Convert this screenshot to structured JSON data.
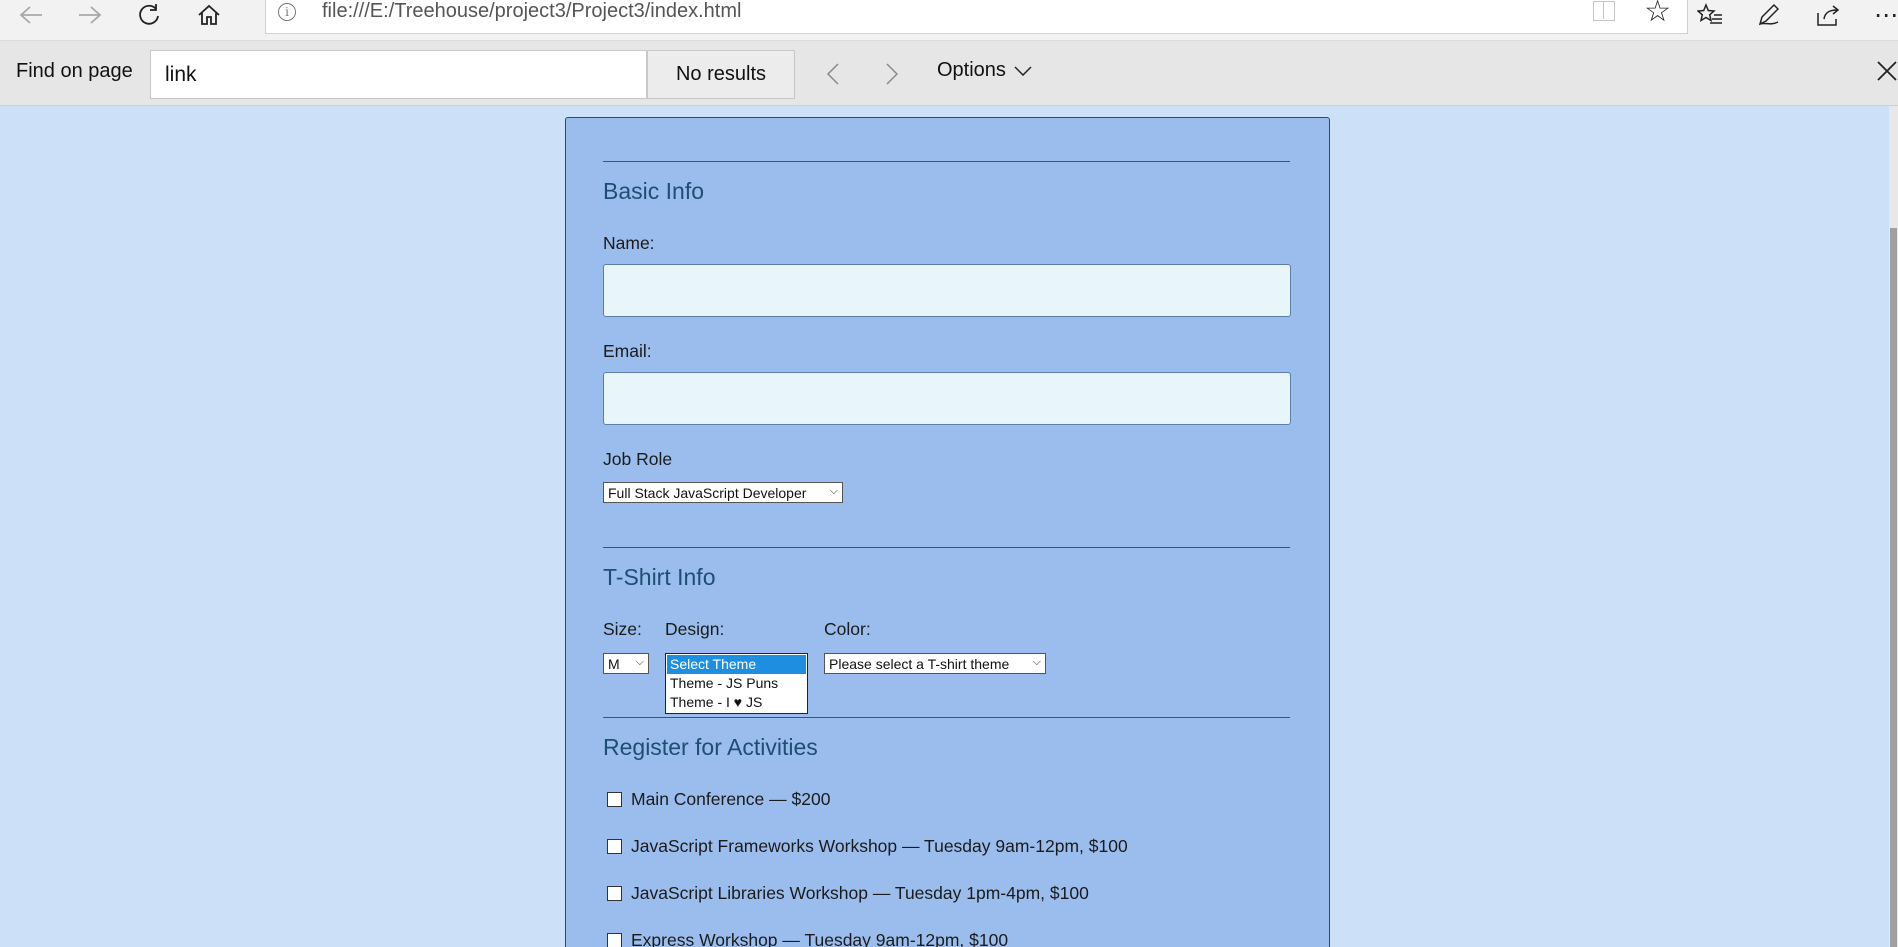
{
  "browser": {
    "url": "file:///E:/Treehouse/project3/Project3/index.html",
    "icons": [
      "back-icon",
      "forward-icon",
      "refresh-icon",
      "home-icon",
      "info-icon",
      "reading-view-icon",
      "favorite-star-icon",
      "favorites-hub-icon",
      "pen-icon",
      "share-icon",
      "more-icon"
    ]
  },
  "find": {
    "label": "Find on page",
    "query": "link",
    "results": "No results",
    "options_label": "Options"
  },
  "form": {
    "basic_info_title": "Basic Info",
    "name_label": "Name:",
    "email_label": "Email:",
    "job_role_label": "Job Role",
    "job_role_value": "Full Stack JavaScript Developer",
    "tshirt_title": "T-Shirt Info",
    "size_label": "Size:",
    "size_value": "M",
    "design_label": "Design:",
    "design_options": [
      "Select Theme",
      "Theme - JS Puns",
      "Theme - I ♥ JS"
    ],
    "color_label": "Color:",
    "color_value": "Please select a T-shirt theme",
    "activities_title": "Register for Activities",
    "activities": [
      "Main Conference — $200",
      "JavaScript Frameworks Workshop — Tuesday 9am-12pm, $100",
      "JavaScript Libraries Workshop — Tuesday 1pm-4pm, $100",
      "Express Workshop — Tuesday 9am-12pm, $100"
    ]
  }
}
